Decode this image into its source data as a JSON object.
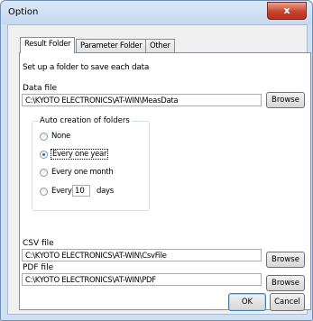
{
  "window": {
    "title": "Option",
    "close_label": "x"
  },
  "tabs": [
    {
      "label": "Result Folder"
    },
    {
      "label": "Parameter Folder"
    },
    {
      "label": "Other"
    }
  ],
  "instructions": "Set up a folder to save each data",
  "data_file": {
    "label": "Data file",
    "value": "C:\\KYOTO ELECTRONICS\\AT-WIN\\MeasData",
    "browse_label": "Browse"
  },
  "auto_creation": {
    "title": "Auto creation of folders",
    "options": [
      {
        "label": "None",
        "checked": false
      },
      {
        "label": "Every one year",
        "checked": true
      },
      {
        "label": "Every one month",
        "checked": false
      },
      {
        "label": "Every",
        "checked": false,
        "value": "10",
        "suffix": "days"
      }
    ]
  },
  "csv_file": {
    "label": "CSV file",
    "value": "C:\\KYOTO ELECTRONICS\\AT-WIN\\CsvFile",
    "browse_label": "Browse"
  },
  "pdf_file": {
    "label": "PDF file",
    "value": "C:\\KYOTO ELECTRONICS\\AT-WIN\\PDF",
    "browse_label": "Browse"
  },
  "footer": {
    "ok_label": "OK",
    "cancel_label": "Cancel"
  }
}
